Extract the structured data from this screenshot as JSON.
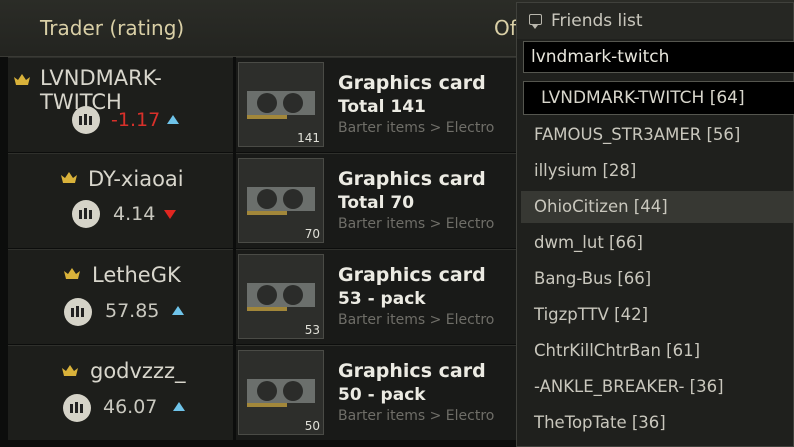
{
  "header": {
    "trader_col": "Trader (rating)",
    "offer_col": "Of"
  },
  "rows": [
    {
      "trader": "LVNDMARK-TWITCH",
      "rating": "-1.17",
      "trend": "up",
      "item_title": "Graphics card",
      "item_sub": "Total 141",
      "item_category": "Barter items > Electro",
      "qty": "141"
    },
    {
      "trader": "DY-xiaoai",
      "rating": "4.14",
      "trend": "down",
      "item_title": "Graphics card",
      "item_sub": "Total 70",
      "item_category": "Barter items > Electro",
      "qty": "70"
    },
    {
      "trader": "LetheGK",
      "rating": "57.85",
      "trend": "up",
      "item_title": "Graphics card",
      "item_sub": "53 - pack",
      "item_category": "Barter items > Electro",
      "qty": "53"
    },
    {
      "trader": "godvzzz_",
      "rating": "46.07",
      "trend": "up",
      "item_title": "Graphics card",
      "item_sub": "50 - pack",
      "item_category": "Barter items > Electro",
      "qty": "50"
    }
  ],
  "friends": {
    "title": "Friends list",
    "search_value": "lvndmark-twitch",
    "selected": "LVNDMARK-TWITCH [64]",
    "items": [
      "FAMOUS_STR3AMER [56]",
      "illysium [28]",
      "OhioCitizen [44]",
      "dwm_lut [66]",
      "Bang-Bus [66]",
      "TigzpTTV [42]",
      "ChtrKillChtrBan [61]",
      "-ANKLE_BREAKER- [36]",
      "TheTopTate [36]"
    ],
    "highlighted_index": 2
  },
  "colors": {
    "accent_gold": "#d9b23a",
    "up_arrow": "#6fc4ea",
    "down_arrow": "#e02620",
    "negative_rating": "#d8302a"
  },
  "icons": [
    "crown-icon",
    "reputation-icon",
    "trend-up-icon",
    "trend-down-icon",
    "graphics-card-icon",
    "chat-icon"
  ]
}
